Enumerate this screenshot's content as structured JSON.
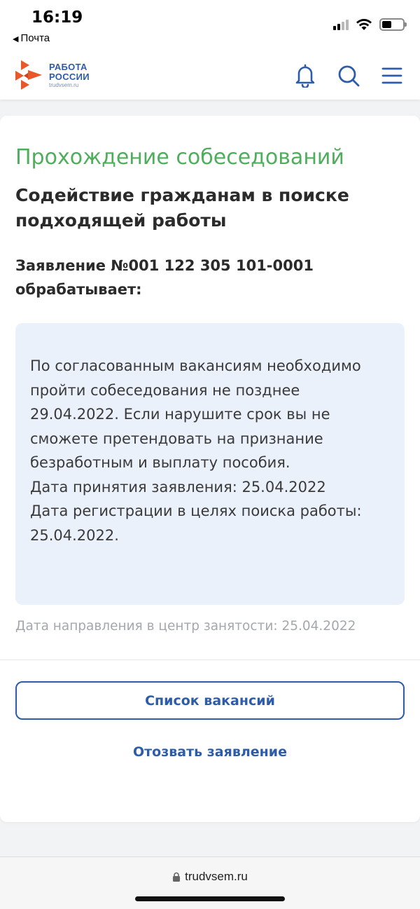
{
  "status_bar": {
    "time": "16:19",
    "back_label": "Почта",
    "back_icon": "back-triangle-icon",
    "battery_level": 0.45
  },
  "header": {
    "logo_line1": "РАБОТА",
    "logo_line2": "РОССИИ",
    "logo_domain": "trudvsem.ru",
    "brand_colors": {
      "primary": "#2d5caa",
      "logo_orange": "#e8582a"
    },
    "icons": [
      "bell-icon",
      "search-icon",
      "menu-icon"
    ]
  },
  "card": {
    "stage_title": "Прохождение собеседований",
    "service_title": "Содействие гражданам в поиске подходящей работы",
    "application_status": "Заявление №001 122 305 101-0001 обрабатывает:",
    "info_paragraph": "По согласованным вакансиям необходимо пройти собеседования не позднее 29.04.2022. Если нарушите срок вы не сможете претендовать на признание безработным и выплату пособия.",
    "acceptance_date": "Дата принятия заявления: 25.04.2022",
    "registration_date": "Дата регистрации в целях поиска работы: 25.04.2022.",
    "referral_date": "Дата направления в центр занятости: 25.04.2022",
    "vacancies_button": "Список вакансий",
    "withdraw_link": "Отозвать заявление"
  },
  "browser": {
    "url": "trudvsem.ru",
    "lock_icon": "lock-icon"
  },
  "colors": {
    "stage_green": "#4fae5c",
    "info_box_bg": "#ebf1fb",
    "muted_text": "#a4a8ae"
  }
}
